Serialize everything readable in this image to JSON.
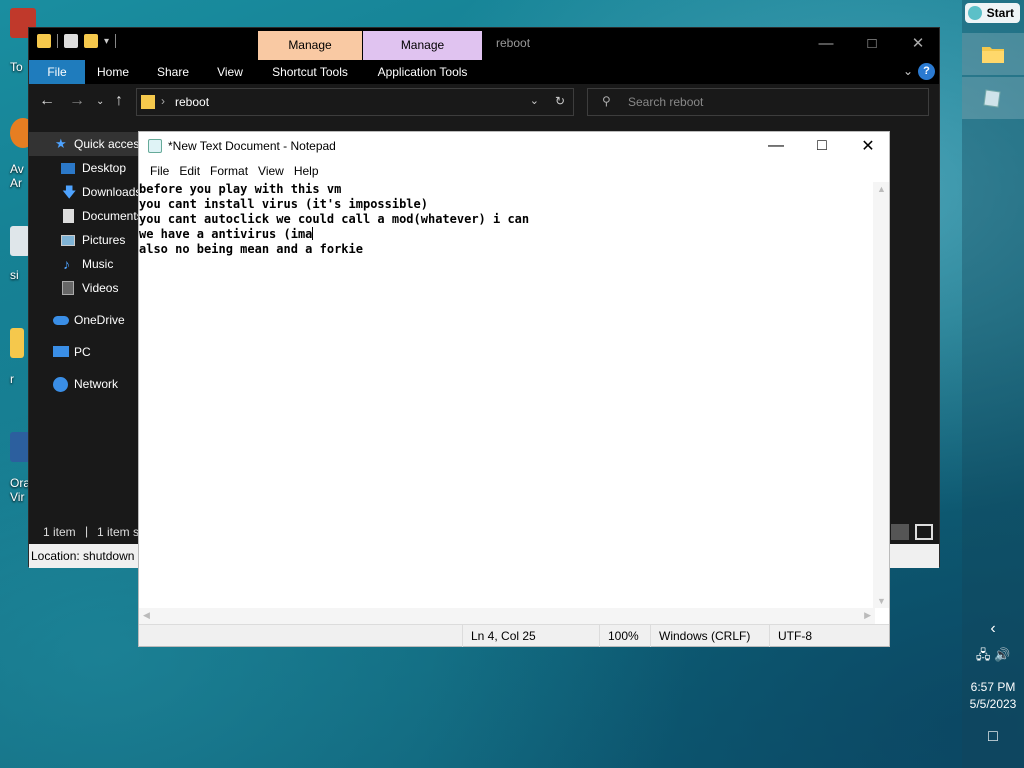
{
  "desktop": {
    "icons": [
      {
        "label": "To",
        "icon": "shield-icon"
      },
      {
        "label": "Av\nAr",
        "icon": "app-icon"
      },
      {
        "label": "si",
        "icon": "file-icon"
      },
      {
        "label": "r",
        "icon": "folder-icon"
      },
      {
        "label": "Ora\nVir",
        "icon": "virtualbox-icon"
      }
    ]
  },
  "taskbar": {
    "start_label": "Start",
    "clock_time": "6:57 PM",
    "clock_date": "5/5/2023"
  },
  "explorer": {
    "title": "reboot",
    "context_tabs": [
      "Manage",
      "Manage"
    ],
    "ribbon_tabs": [
      "File",
      "Home",
      "Share",
      "View",
      "Shortcut Tools",
      "Application Tools"
    ],
    "address": "reboot",
    "search_placeholder": "Search reboot",
    "nav": [
      {
        "label": "Quick access",
        "icon": "star-icon"
      },
      {
        "label": "Desktop",
        "icon": "desktop-icon"
      },
      {
        "label": "Downloads",
        "icon": "download-icon"
      },
      {
        "label": "Documents",
        "icon": "document-icon"
      },
      {
        "label": "Pictures",
        "icon": "pictures-icon"
      },
      {
        "label": "Music",
        "icon": "music-icon"
      },
      {
        "label": "Videos",
        "icon": "videos-icon"
      },
      {
        "label": "OneDrive",
        "icon": "cloud-icon"
      },
      {
        "label": "PC",
        "icon": "pc-icon"
      },
      {
        "label": "Network",
        "icon": "network-icon"
      }
    ],
    "status_items": "1 item",
    "status_selected": "1 item s",
    "location": "Location: shutdown"
  },
  "notepad": {
    "title": "*New Text Document - Notepad",
    "menu": [
      "File",
      "Edit",
      "Format",
      "View",
      "Help"
    ],
    "lines": [
      "before you play with this vm",
      "you cant install virus (it's impossible)",
      "you cant autoclick we could call a mod(whatever) i can",
      "we have a antivirus (ima",
      "also no being mean and a forkie"
    ],
    "status": {
      "position": "Ln 4, Col 25",
      "zoom": "100%",
      "line_ending": "Windows (CRLF)",
      "encoding": "UTF-8"
    }
  },
  "colors": {
    "file_tab": "#1f7cbd",
    "manage_orange": "#f9c9a3",
    "manage_purple": "#e0c3f0",
    "explorer_bg": "#191919"
  }
}
